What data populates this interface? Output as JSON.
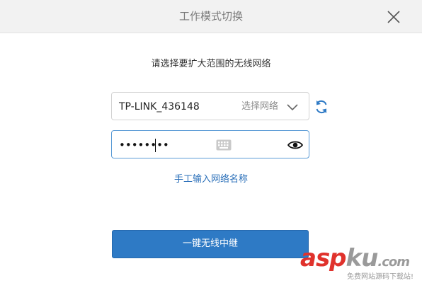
{
  "window": {
    "title": "工作模式切换",
    "close_icon": "close-icon"
  },
  "form": {
    "prompt": "请选择要扩大范围的无线网络",
    "ssid_value": "TP-LINK_436148",
    "select_network_label": "选择网络",
    "password_masked": "••••••••",
    "manual_link": "手工输入网络名称",
    "submit_label": "一键无线中继"
  },
  "icons": {
    "dropdown": "chevron-down-icon",
    "refresh": "refresh-icon",
    "keyboard": "keyboard-icon",
    "show_password": "eye-icon"
  },
  "watermark": {
    "logo_asp": "asp",
    "logo_ku": "ku",
    "logo_tld": ".com",
    "subtitle": "免费网站源码下载站!"
  },
  "colors": {
    "primary": "#2e7ac5",
    "link": "#2a6fb9",
    "focus_border": "#5b9bd6",
    "titlebar_bg": "#f2f2f2",
    "refresh_icon": "#2e7ac5"
  }
}
